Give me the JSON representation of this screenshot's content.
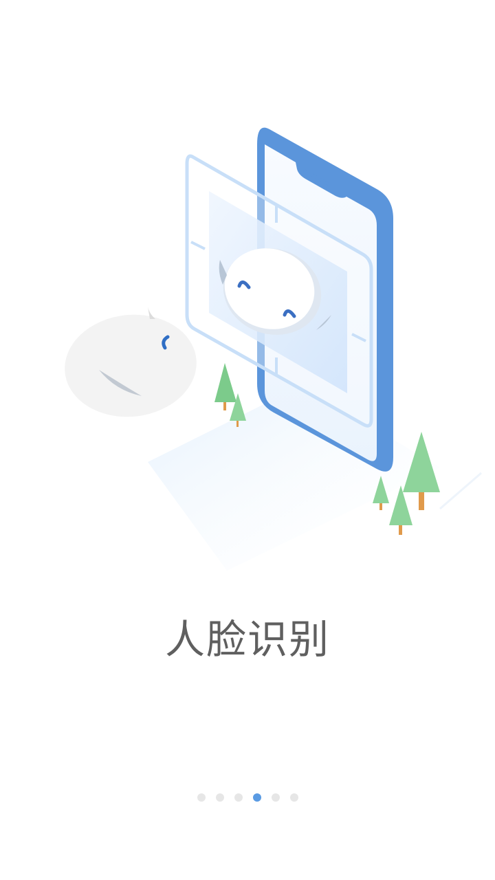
{
  "onboarding": {
    "title": "人脸识别",
    "page_count": 6,
    "active_page_index": 3
  },
  "icons": {
    "illustration": "face-recognition-phone-illustration"
  },
  "colors": {
    "accent": "#5A9BE3",
    "phone_body": "#5B95DB",
    "title_text": "#5F5F5F",
    "dot_inactive": "#E6E6E6",
    "tree": "#7CCB8B"
  }
}
